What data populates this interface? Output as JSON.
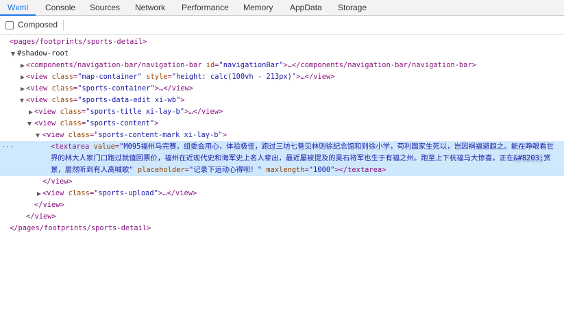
{
  "tabs": [
    {
      "label": "Wxml"
    },
    {
      "label": "Console"
    },
    {
      "label": "Sources"
    },
    {
      "label": "Network"
    },
    {
      "label": "Performance"
    },
    {
      "label": "Memory"
    },
    {
      "label": "AppData"
    },
    {
      "label": "Storage"
    }
  ],
  "active_tab": "Wxml",
  "accent_color": "#1a73e8",
  "selected_row_color": "#cfe8fc",
  "toolbar": {
    "composed_label": "Composed",
    "composed_checked": false
  },
  "tree": {
    "root_open": "<pages/footprints/sports-detail>",
    "shadow_root": "#shadow-root",
    "nav_bar": {
      "open": "<components/navigation-bar/navigation-bar",
      "attr": "id",
      "val": "\"navigationBar\"",
      "close": ">…</components/navigation-bar/navigation-bar>"
    },
    "map_container": {
      "open": "<view",
      "attr1": "class",
      "val1": "\"map-container\"",
      "attr2": "style",
      "val2": "\"height: calc(100vh - 213px)\"",
      "close": ">…</view>"
    },
    "sports_container": {
      "open": "<view",
      "attr": "class",
      "val": "\"sports-container\"",
      "close": ">…</view>"
    },
    "sports_data_edit": {
      "open": "<view",
      "attr": "class",
      "val": "\"sports-data-edit xi-wb\"",
      "close": ">"
    },
    "sports_title": {
      "open": "<view",
      "attr": "class",
      "val": "\"sports-title xi-lay-b\"",
      "close": ">…</view>"
    },
    "sports_content": {
      "open": "<view",
      "attr": "class",
      "val": "\"sports-content\"",
      "close": ">"
    },
    "content_mark": {
      "open": "<view",
      "attr": "class",
      "val": "\"sports-content-mark xi-lay-b\"",
      "close": ">"
    },
    "textarea": {
      "open": "<textarea",
      "attr_value": "value",
      "value_part1": "\"M095福州马完赛，组委会用心，体验极佳，跑过三坊七巷见林则徐纪念馆和则徐小学，苟利国家生死以，岂因祸福避趋之。能在睁眼看世界的林大人家门口跑过就值回票价，福州在近现代史和海军史上名人辈出，最近屡被提及的吴石将军也生于有福之州。跑至上下杭福马大惊喜，正在",
      "value_entity": "&#8203;",
      "value_part2": "赏景，居然听到有人高喊歌\"",
      "attr_placeholder": "placeholder",
      "placeholder": "\"记录下运动心得呗！\"",
      "attr_maxlength": "maxlength",
      "maxlength": "\"1000\"",
      "close": "></textarea>"
    },
    "dots": "···",
    "close_view": "</view>",
    "sports_upload": {
      "open": "<view",
      "attr": "class",
      "val": "\"sports-upload\"",
      "close": ">…</view>"
    },
    "root_close": "</pages/footprints/sports-detail>"
  }
}
